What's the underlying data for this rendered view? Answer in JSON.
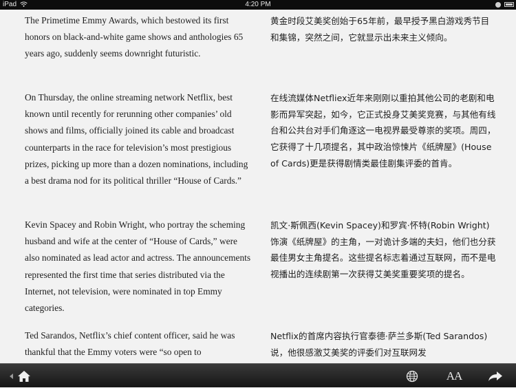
{
  "status_bar": {
    "device": "iPad",
    "time": "4:20 PM"
  },
  "paragraphs": [
    {
      "en": "The Primetime Emmy Awards, which bestowed its first honors on black-and-white game shows and anthologies 65 years ago, suddenly seems downright futuristic.",
      "zh": "黄金时段艾美奖创始于65年前，最早授予黑白游戏秀节目和集锦，突然之间，它就显示出未来主义倾向。"
    },
    {
      "en": "On Thursday, the online streaming network Netflix, best known until recently for rerunning other companies’ old shows and films, officially joined its cable and broadcast counterparts in the race for television’s most prestigious prizes, picking up more than a dozen nominations, including a best drama nod for its political thriller “House of Cards.”",
      "zh": "在线流媒体Netfliex近年来刚刚以重拍其他公司的老剧和电影而异军突起，如今，它正式投身艾美奖竞赛，与其他有线台和公共台对手们角逐这一电视界最受尊崇的奖项。周四，它获得了十几项提名，其中政治惊悚片《纸牌屋》(House of Cards)更是获得剧情类最佳剧集评委的首肯。"
    },
    {
      "en": "Kevin Spacey and Robin Wright, who portray the scheming husband and wife at the center of “House of Cards,” were also nominated as lead actor and actress. The announcements represented the first time that series distributed via the Internet, not television, were nominated in top Emmy categories.",
      "zh": "凯文·斯佩西(Kevin Spacey)和罗宾·怀特(Robin Wright)饰演《纸牌屋》的主角，一对诡计多端的夫妇，他们也分获最佳男女主角提名。这些提名标志着通过互联网，而不是电视播出的连续剧第一次获得艾美奖重要奖项的提名。"
    },
    {
      "en": "Ted Sarandos, Netflix’s chief content officer, said he was thankful that the Emmy voters were “so open to",
      "zh": "Netflix的首席内容执行官泰德·萨兰多斯(Ted Sarandos)说，他很感激艾美奖的评委们对互联网发"
    }
  ],
  "toolbar": {
    "font_button_label": "AA"
  }
}
